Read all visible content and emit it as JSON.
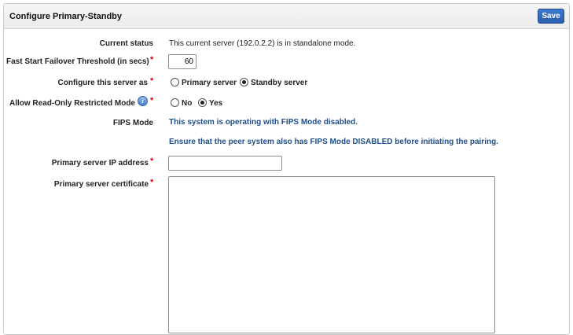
{
  "panel": {
    "title": "Configure Primary-Standby",
    "save_label": "Save"
  },
  "form": {
    "current_status": {
      "label": "Current status",
      "value": "This current server (192.0.2.2) is in standalone mode."
    },
    "failover_threshold": {
      "label": "Fast Start Failover Threshold (in secs)",
      "value": "60"
    },
    "configure_as": {
      "label": "Configure this server as",
      "options": [
        "Primary server",
        "Standby server"
      ],
      "selected": "Standby server"
    },
    "read_only_mode": {
      "label": "Allow Read-Only Restricted Mode",
      "options": [
        "No",
        "Yes"
      ],
      "selected": "Yes",
      "icon": "info-icon"
    },
    "fips_mode": {
      "label": "FIPS Mode",
      "message": "This system is operating with FIPS Mode disabled.",
      "note": "Ensure that the peer system also has FIPS Mode DISABLED before initiating the pairing."
    },
    "primary_ip": {
      "label": "Primary server IP address",
      "value": ""
    },
    "primary_cert": {
      "label": "Primary server certificate",
      "value": ""
    },
    "required_mark": "*"
  },
  "colors": {
    "accent": "#2a5ea8",
    "required": "#d0021b",
    "info_text": "#1f4f8a"
  }
}
